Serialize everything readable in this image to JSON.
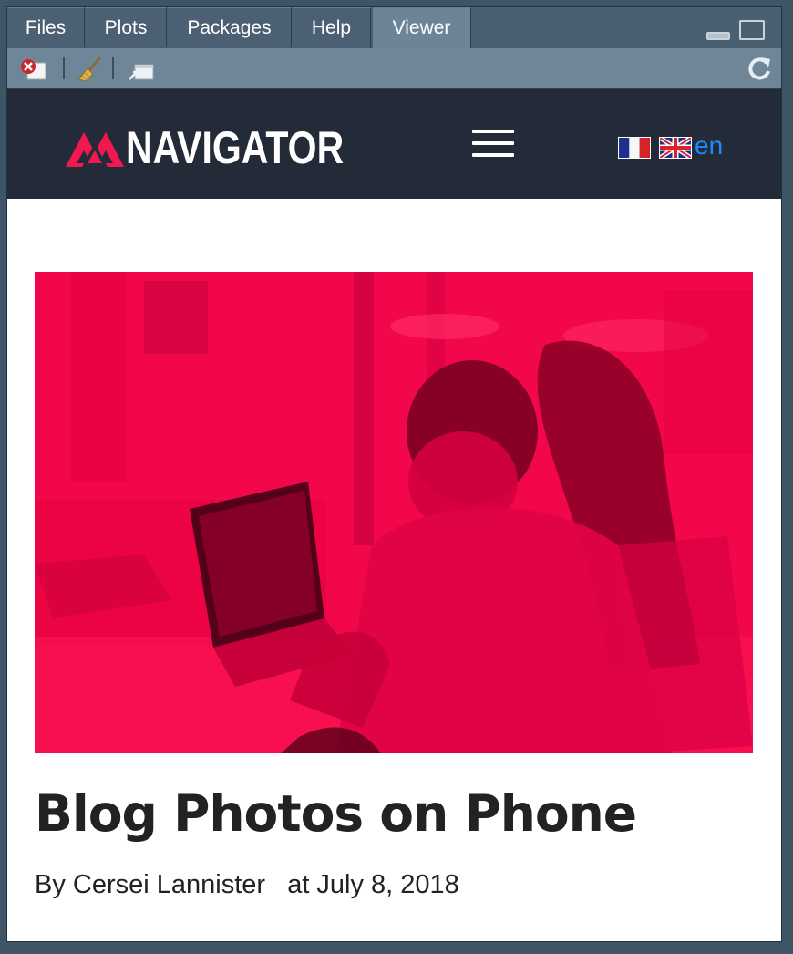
{
  "tabs": [
    {
      "label": "Files",
      "active": false
    },
    {
      "label": "Plots",
      "active": false
    },
    {
      "label": "Packages",
      "active": false
    },
    {
      "label": "Help",
      "active": false
    },
    {
      "label": "Viewer",
      "active": true
    }
  ],
  "toolbar": {
    "icons": [
      "clear-viewer-icon",
      "broom-icon",
      "export-icon",
      "refresh-icon"
    ]
  },
  "site": {
    "logo_text": "NAVIGATOR",
    "lang_label": "en",
    "flags": [
      "france-flag",
      "uk-flag"
    ],
    "colors": {
      "header_bg": "#232b38",
      "accent": "#f2064a",
      "link": "#1e88ff"
    }
  },
  "post": {
    "title": "Blog Photos on Phone",
    "by_label": "By",
    "author": "Cersei Lannister",
    "date_label": "at July 8, 2018"
  }
}
